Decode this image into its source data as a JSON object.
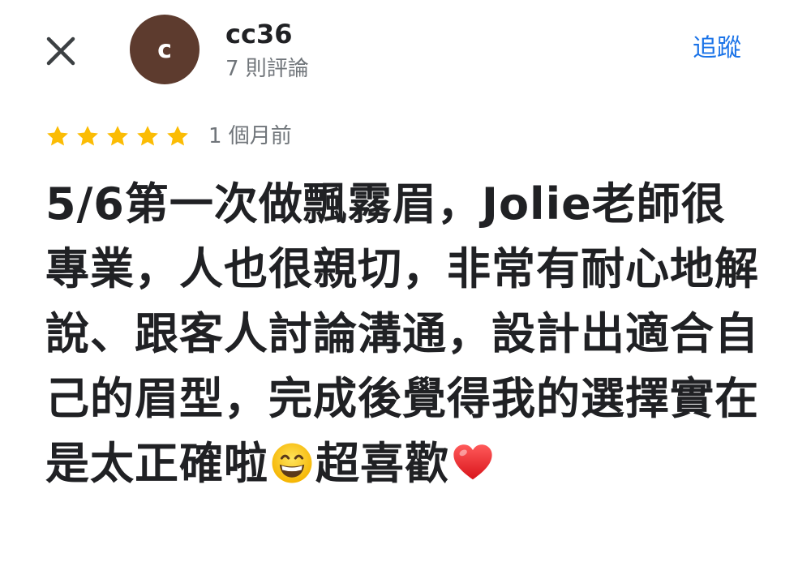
{
  "reviewer": {
    "avatar_letter": "c",
    "name": "cc36",
    "review_count": "7 則評論",
    "avatar_color": "#5d3b2e"
  },
  "actions": {
    "close_icon": "close-icon",
    "follow_label": "追蹤",
    "accent_color": "#1a73e8"
  },
  "review": {
    "rating": 5,
    "max_rating": 5,
    "star_color": "#fbbc04",
    "time": "1 個月前",
    "text_part1": "5/6第一次做飄霧眉，Jolie老師很專業，人也很親切，非常有耐心地解說、跟客人討論溝通，設計出適合自己的眉型，完成後覺得我的選擇實在是太正確啦",
    "emoji1": "grinning-face-emoji",
    "text_part2": "超喜歡",
    "emoji2": "red-heart-emoji"
  }
}
